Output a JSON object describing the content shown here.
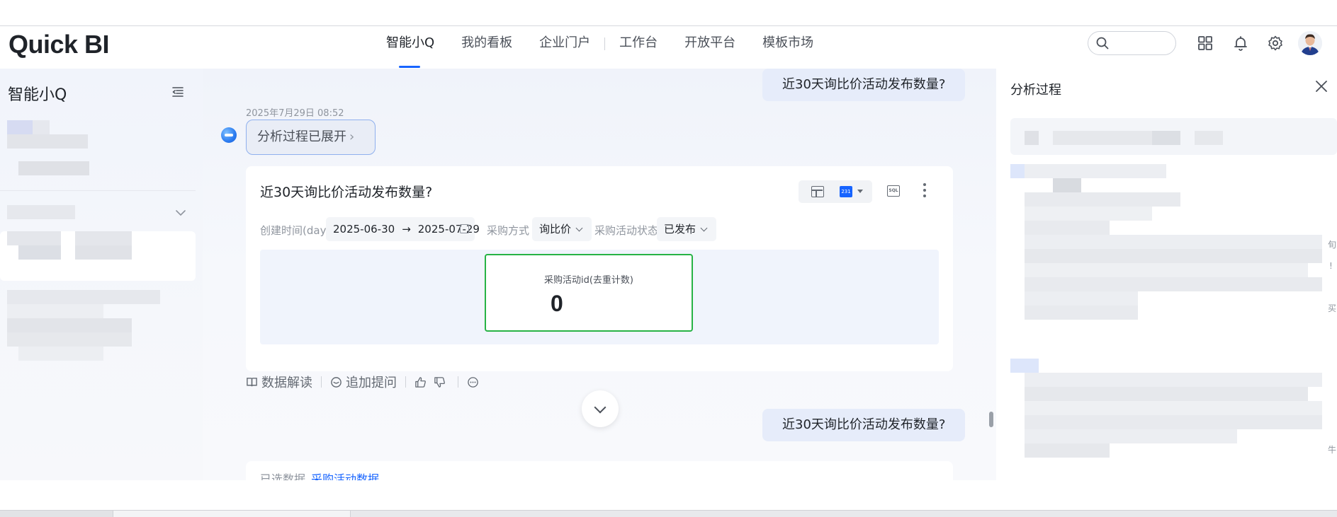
{
  "header": {
    "logo": "Quick BI",
    "nav": [
      {
        "label": "智能小Q",
        "active": true
      },
      {
        "label": "我的看板",
        "active": false
      },
      {
        "label": "企业门户",
        "active": false
      },
      {
        "label": "工作台",
        "active": false
      },
      {
        "label": "开放平台",
        "active": false
      },
      {
        "label": "模板市场",
        "active": false
      }
    ],
    "icons": [
      "search-icon",
      "apps-grid-icon",
      "bell-icon",
      "gear-icon",
      "avatar"
    ]
  },
  "sidebar": {
    "title": "智能小Q"
  },
  "conversation": {
    "question_1": "近30天询比价活动发布数量?",
    "timestamp": "2025年7月29日 08:52",
    "analysis_toggle": "分析过程已展开",
    "card": {
      "title": "近30天询比价活动发布数量?",
      "filters": {
        "time_label": "创建时间(day)",
        "date_start": "2025-06-30",
        "date_end": "2025-07-29",
        "method_label": "采购方式",
        "method_value": "询比价",
        "status_label": "采购活动状态",
        "status_value": "已发布"
      },
      "kpi": {
        "label": "采购活动id(去重计数)",
        "value": "0"
      },
      "kpi_icon_text": "231",
      "sql_icon_text": "SQL"
    },
    "actions": {
      "interpret": "数据解读",
      "followup": "追加提问"
    },
    "question_2": "近30天询比价活动发布数量?",
    "card2": {
      "label": "已选数据",
      "link": "采购活动数据"
    }
  },
  "right_panel": {
    "title": "分析过程",
    "edge_chars": [
      "旬",
      "!",
      "买",
      "牛"
    ]
  },
  "colors": {
    "accent": "#1764ff",
    "kpi_border": "#27b345",
    "user_bubble": "#e6ecfa"
  }
}
